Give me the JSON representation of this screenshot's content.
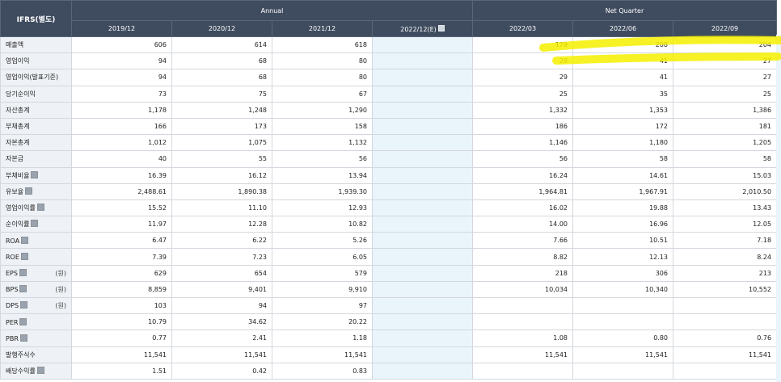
{
  "header": {
    "corner": "IFRS(별도)",
    "annual": "Annual",
    "quarter": "Net Quarter",
    "columns": [
      "2019/12",
      "2020/12",
      "2021/12",
      "2022/12(E)",
      "2022/03",
      "2022/06",
      "2022/09"
    ]
  },
  "rows": [
    {
      "label": "매출액",
      "help": false,
      "unit": "",
      "values": [
        "606",
        "614",
        "618",
        "",
        "179",
        "208",
        "204"
      ]
    },
    {
      "label": "영업이익",
      "help": false,
      "unit": "",
      "values": [
        "94",
        "68",
        "80",
        "",
        "29",
        "41",
        "27"
      ]
    },
    {
      "label": "영업이익(발표기준)",
      "help": false,
      "unit": "",
      "values": [
        "94",
        "68",
        "80",
        "",
        "29",
        "41",
        "27"
      ]
    },
    {
      "label": "당기순이익",
      "help": false,
      "unit": "",
      "values": [
        "73",
        "75",
        "67",
        "",
        "25",
        "35",
        "25"
      ]
    },
    {
      "label": "자산총계",
      "help": false,
      "unit": "",
      "values": [
        "1,178",
        "1,248",
        "1,290",
        "",
        "1,332",
        "1,353",
        "1,386"
      ]
    },
    {
      "label": "부채총계",
      "help": false,
      "unit": "",
      "values": [
        "166",
        "173",
        "158",
        "",
        "186",
        "172",
        "181"
      ]
    },
    {
      "label": "자본총계",
      "help": false,
      "unit": "",
      "values": [
        "1,012",
        "1,075",
        "1,132",
        "",
        "1,146",
        "1,180",
        "1,205"
      ]
    },
    {
      "label": "자본금",
      "help": false,
      "unit": "",
      "values": [
        "40",
        "55",
        "56",
        "",
        "56",
        "58",
        "58"
      ]
    },
    {
      "label": "부채비율",
      "help": true,
      "unit": "",
      "values": [
        "16.39",
        "16.12",
        "13.94",
        "",
        "16.24",
        "14.61",
        "15.03"
      ]
    },
    {
      "label": "유보율",
      "help": true,
      "unit": "",
      "values": [
        "2,488.61",
        "1,890.38",
        "1,939.30",
        "",
        "1,964.81",
        "1,967.91",
        "2,010.50"
      ]
    },
    {
      "label": "영업이익률",
      "help": true,
      "unit": "",
      "values": [
        "15.52",
        "11.10",
        "12.93",
        "",
        "16.02",
        "19.88",
        "13.43"
      ]
    },
    {
      "label": "순이익률",
      "help": true,
      "unit": "",
      "values": [
        "11.97",
        "12.28",
        "10.82",
        "",
        "14.00",
        "16.96",
        "12.05"
      ]
    },
    {
      "label": "ROA",
      "help": true,
      "unit": "",
      "values": [
        "6.47",
        "6.22",
        "5.26",
        "",
        "7.66",
        "10.51",
        "7.18"
      ]
    },
    {
      "label": "ROE",
      "help": true,
      "unit": "",
      "values": [
        "7.39",
        "7.23",
        "6.05",
        "",
        "8.82",
        "12.13",
        "8.24"
      ]
    },
    {
      "label": "EPS",
      "help": true,
      "unit": "(원)",
      "values": [
        "629",
        "654",
        "579",
        "",
        "218",
        "306",
        "213"
      ]
    },
    {
      "label": "BPS",
      "help": true,
      "unit": "(원)",
      "values": [
        "8,859",
        "9,401",
        "9,910",
        "",
        "10,034",
        "10,340",
        "10,552"
      ]
    },
    {
      "label": "DPS",
      "help": true,
      "unit": "(원)",
      "values": [
        "103",
        "94",
        "97",
        "",
        "",
        "",
        ""
      ]
    },
    {
      "label": "PER",
      "help": true,
      "unit": "",
      "values": [
        "10.79",
        "34.62",
        "20.22",
        "",
        "",
        "",
        ""
      ]
    },
    {
      "label": "PBR",
      "help": true,
      "unit": "",
      "values": [
        "0.77",
        "2.41",
        "1.18",
        "",
        "1.08",
        "0.80",
        "0.76"
      ]
    },
    {
      "label": "발행주식수",
      "help": false,
      "unit": "",
      "values": [
        "11,541",
        "11,541",
        "11,541",
        "",
        "11,541",
        "11,541",
        "11,541"
      ]
    },
    {
      "label": "배당수익률",
      "help": true,
      "unit": "",
      "values": [
        "1.51",
        "0.42",
        "0.83",
        "",
        "",
        "",
        ""
      ]
    }
  ],
  "highlight_color": "#f5f000"
}
